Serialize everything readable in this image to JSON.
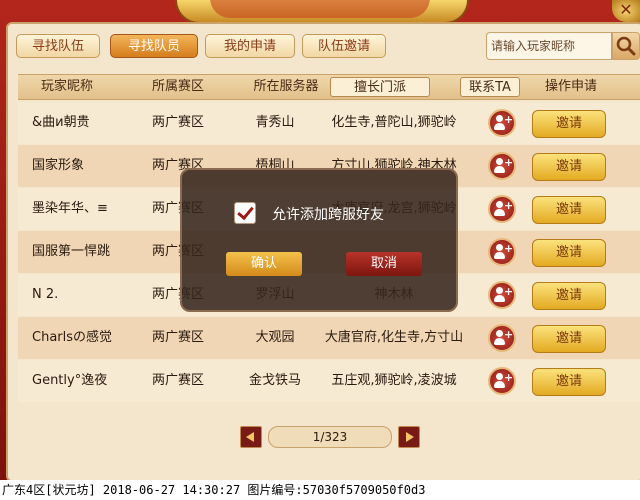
{
  "window": {
    "close_icon": "close-icon"
  },
  "tabs": [
    {
      "label": "寻找队伍",
      "active": false
    },
    {
      "label": "寻找队员",
      "active": true
    },
    {
      "label": "我的申请",
      "active": false
    },
    {
      "label": "队伍邀请",
      "active": false
    }
  ],
  "search": {
    "placeholder": "请输入玩家昵称",
    "icon": "search-icon"
  },
  "table": {
    "headers": [
      "玩家昵称",
      "所属赛区",
      "所在服务器",
      "擅长门派",
      "联系TA",
      "操作申请"
    ],
    "rows": [
      {
        "name": "&曲и朝贵",
        "region": "两广赛区",
        "server": "青秀山",
        "sects": "化生寺,普陀山,狮驼岭",
        "invite": "邀请"
      },
      {
        "name": "国家形象",
        "region": "两广赛区",
        "server": "梧桐山",
        "sects": "方寸山,狮驼岭,神木林",
        "invite": "邀请"
      },
      {
        "name": "墨染年华、≡",
        "region": "两广赛区",
        "server": "",
        "sects": "大唐官府,龙宫,狮驼岭",
        "invite": "邀请"
      },
      {
        "name": "国服第一悍跳",
        "region": "两广赛区",
        "server": "",
        "sects": "",
        "invite": "邀请"
      },
      {
        "name": "N 2.",
        "region": "两广赛区",
        "server": "罗浮山",
        "sects": "神木林",
        "invite": "邀请"
      },
      {
        "name": "Charlsの感觉",
        "region": "两广赛区",
        "server": "大观园",
        "sects": "大唐官府,化生寺,方寸山",
        "invite": "邀请"
      },
      {
        "name": "Gently°逸夜",
        "region": "两广赛区",
        "server": "金戈铁马",
        "sects": "五庄观,狮驼岭,凌波城",
        "invite": "邀请"
      }
    ]
  },
  "pager": {
    "text": "1/323"
  },
  "dialog": {
    "checkbox_label": "允许添加跨服好友",
    "checked": true,
    "ok": "确认",
    "cancel": "取消"
  },
  "status_bar": "广东4区[状元坊] 2018-06-27 14:30:27 图片编号:57030f5709050f0d3"
}
